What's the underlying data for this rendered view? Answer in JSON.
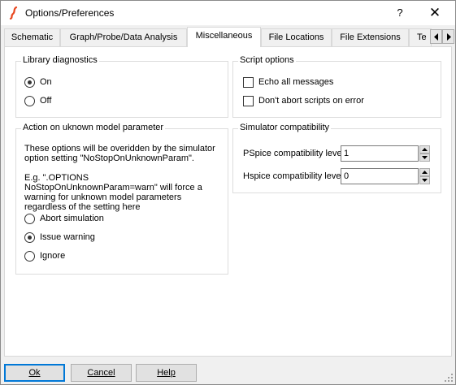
{
  "window": {
    "title": "Options/Preferences",
    "help_glyph": "?",
    "close_glyph": "✕"
  },
  "tabs": [
    {
      "label": "Schematic"
    },
    {
      "label": "Graph/Probe/Data Analysis"
    },
    {
      "label": "Miscellaneous",
      "active": true
    },
    {
      "label": "File Locations"
    },
    {
      "label": "File Extensions"
    },
    {
      "label": "Te"
    }
  ],
  "library_diagnostics": {
    "title": "Library diagnostics",
    "options": [
      {
        "label": "On",
        "selected": true
      },
      {
        "label": "Off",
        "selected": false
      }
    ]
  },
  "script_options": {
    "title": "Script options",
    "options": [
      {
        "label": "Echo all messages",
        "checked": false
      },
      {
        "label": "Don't abort scripts on error",
        "checked": false
      }
    ]
  },
  "unknown_param": {
    "title": "Action on uknown model parameter",
    "info1": "These options will be overidden by the simulator option setting \"NoStopOnUnknownParam\".",
    "info2": "E.g. \".OPTIONS NoStopOnUnknownParam=warn\" will force a warning for unknown model parameters regardless of the setting here",
    "options": [
      {
        "label": "Abort simulation",
        "selected": false
      },
      {
        "label": "Issue warning",
        "selected": true
      },
      {
        "label": "Ignore",
        "selected": false
      }
    ]
  },
  "simulator_compat": {
    "title": "Simulator compatibility",
    "pspice_label": "PSpice compatibility level",
    "pspice_value": "1",
    "hspice_label": "Hspice compatibility level",
    "hspice_value": "0"
  },
  "buttons": {
    "ok": "Ok",
    "cancel": "Cancel",
    "help": "Help"
  },
  "colors": {
    "app_icon": "#e8461e",
    "accent": "#0078d7"
  }
}
